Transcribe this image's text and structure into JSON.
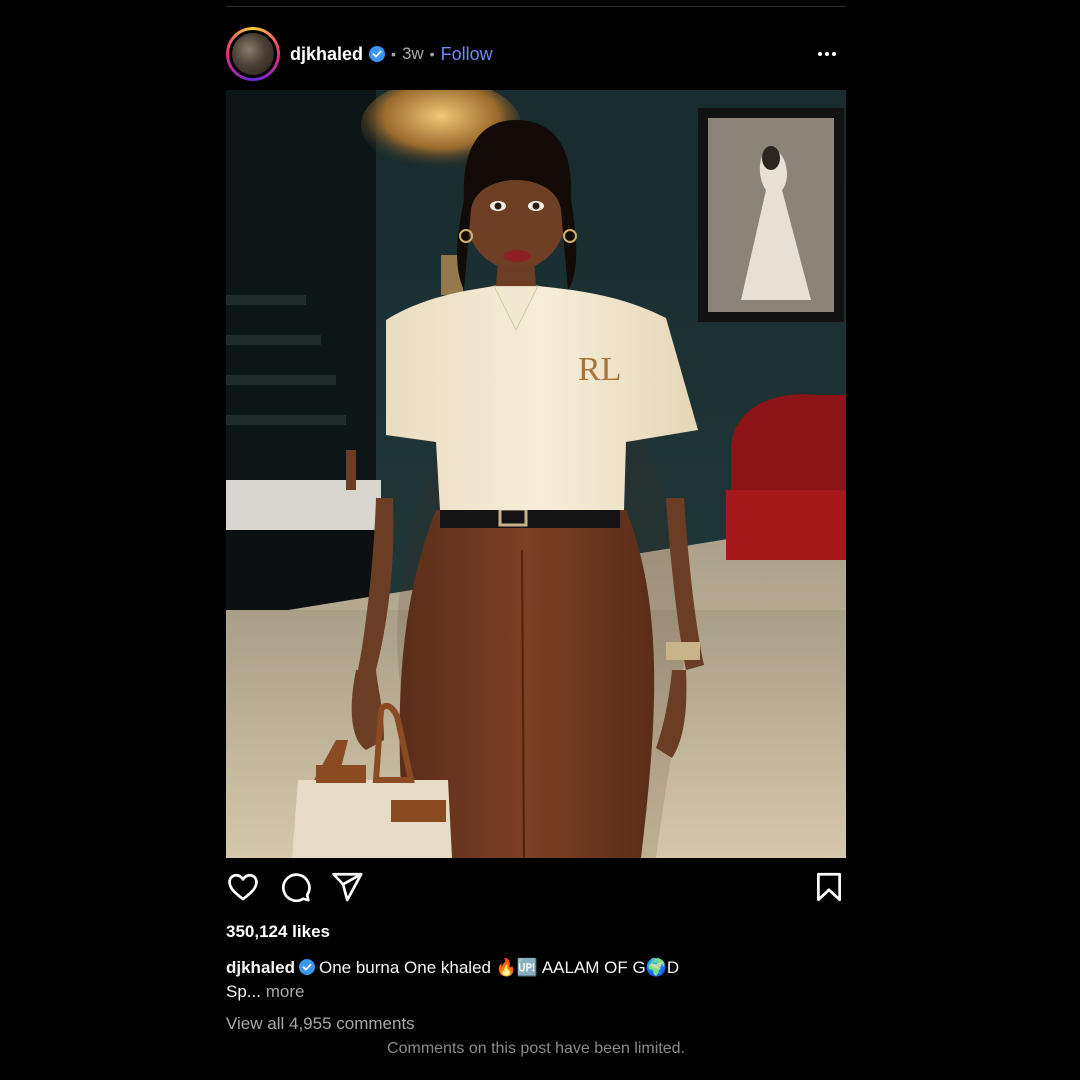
{
  "post": {
    "username": "djkhaled",
    "age": "3w",
    "separator": "•",
    "follow_label": "Follow",
    "likes": "350,124 likes",
    "caption_user": "djkhaled",
    "caption_text": "One burna One khaled 🔥🆙 AALAM OF G🌍D",
    "caption_text_line2": "Sp...",
    "more_label": "more",
    "view_comments": "View all 4,955 comments",
    "limited_notice": "Comments on this post have been limited.",
    "shirt_monogram": "RL"
  },
  "icons": {
    "verified": "verified-badge-icon",
    "more": "more-options-icon",
    "like": "heart-icon",
    "comment": "comment-bubble-icon",
    "share": "paper-plane-icon",
    "save": "bookmark-icon"
  },
  "colors": {
    "background": "#000000",
    "link_blue": "#6f8cf7",
    "verified_blue": "#3897f0",
    "muted_text": "#a8a8a8"
  }
}
